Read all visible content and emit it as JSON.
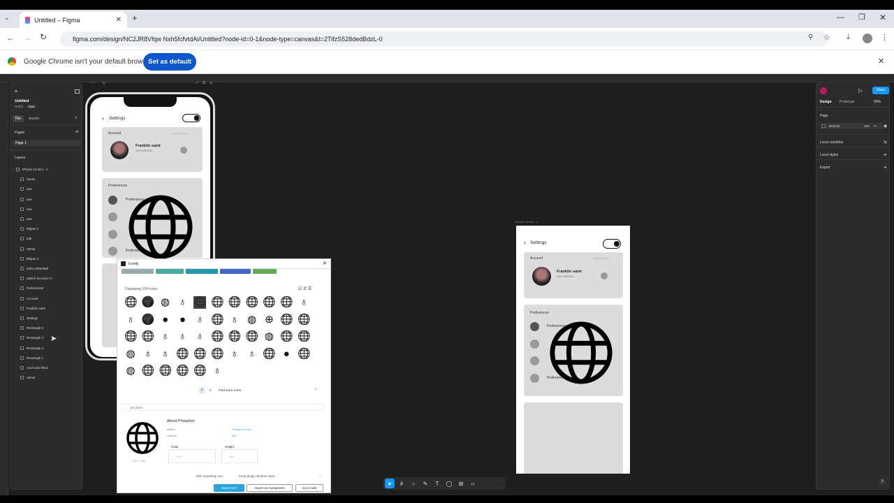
{
  "browser": {
    "tab_title": "Untitled – Figma",
    "url": "figma.com/design/NC2JR8Vfqw Nxh5fcfvtdAi/Untitled?node-id=0-1&node-type=canvas&t=2TifzS528dedBdzL-0",
    "infobar_text": "Google Chrome isn't your default browser",
    "set_default_label": "Set as default"
  },
  "figma": {
    "file_name": "Untitled",
    "drafts_label": "Drafts",
    "plan_badge": "Free",
    "file_tab": "File",
    "assets_tab": "Assets",
    "pages_label": "Pages",
    "page_name": "Page 1",
    "layers_label": "Layers",
    "layers": [
      "iPhone 13 mini - 1",
      "Vector",
      "one",
      "one",
      "one",
      "one",
      "Ellipse 2",
      "edit",
      "Vector",
      "Ellipse 3",
      "0302 34567890",
      "Switch account >>",
      "Preferences",
      "Account",
      "Franklin saint",
      "Settings",
      "Rectangle 2",
      "Rectangle 3",
      "Rectangle 4",
      "Rectangle 1",
      "mod toolx-filled",
      "Vector"
    ],
    "right": {
      "design_tab": "Design",
      "prototype_tab": "Prototype",
      "zoom": "99%",
      "share_label": "Share",
      "page_section": "Page",
      "page_color": "1E1E1E",
      "page_opacity": "100",
      "pct": "%",
      "local_variables": "Local variables",
      "local_styles": "Local styles",
      "export": "Export"
    },
    "frame_label": "iPhone 13 mini - 1"
  },
  "phone": {
    "title": "Settings",
    "account_label": "Account",
    "switch_account": "Switch account >>",
    "user_name": "Franklin saint",
    "user_phone": "0302 34567890",
    "preferences_label": "Preferences",
    "pref_item": "Preferences"
  },
  "plugin": {
    "title": "Iconify",
    "displaying": "Displaying 104 icons:",
    "page1": "1",
    "page2": "2",
    "find_more": "Find more icons",
    "selected_icon": "ph:globe",
    "size_label": "256 × 256",
    "about_title": "About Phosphor:",
    "author_label": "Author:",
    "author_value": "Phosphor Icons",
    "license_label": "License:",
    "license_value": "MIT",
    "color_label": "Color",
    "color_placeholder": "#000",
    "height_label": "Height",
    "height_placeholder": "Auto",
    "after_import_label": "After importing icon:",
    "after_import_value": "Keep plugin window open",
    "import_icon": "Import Icon",
    "import_component": "Import as Component",
    "icon_code": "Icon Code"
  },
  "icons": {
    "grid": [
      "globe-icon",
      "globe-hemisphere-icon",
      "globe-simple-icon",
      "desk-globe-icon",
      "globe-icon",
      "globe-icon",
      "globe-icon",
      "globe-icon",
      "globe-icon",
      "globe-icon",
      "desk-globe-icon",
      "desk-globe-icon",
      "globe-hemisphere-icon",
      "globe-filled-icon",
      "globe-filled-icon",
      "desk-globe-icon",
      "globe-icon",
      "desk-globe-icon",
      "globe-simple-icon",
      "globe-grid-icon",
      "globe-icon",
      "globe-icon",
      "globe-icon",
      "globe-icon",
      "desk-globe-icon",
      "desk-globe-icon",
      "desk-globe-icon",
      "globe-icon",
      "globe-icon",
      "globe-icon",
      "globe-simple-icon",
      "globe-icon",
      "globe-icon",
      "globe-simple-icon",
      "desk-globe-icon",
      "desk-globe-icon",
      "globe-icon",
      "globe-icon",
      "globe-icon",
      "desk-globe-icon",
      "desk-globe-icon",
      "globe-icon",
      "globe-filled-icon",
      "globe-icon",
      "globe-simple-icon",
      "globe-icon",
      "globe-icon",
      "globe-icon",
      "globe-icon",
      "desk-globe-icon"
    ]
  }
}
